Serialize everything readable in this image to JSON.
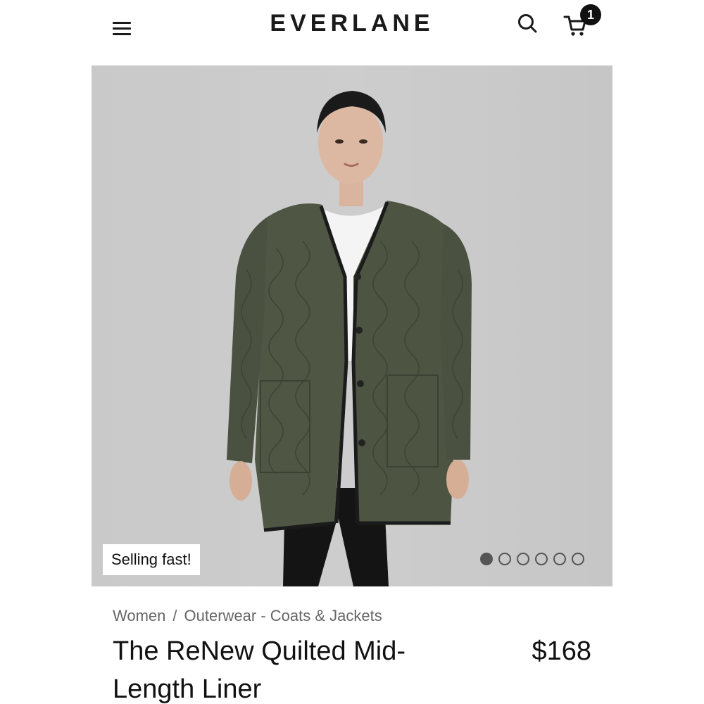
{
  "header": {
    "logo": "EVERLANE",
    "cart_count": "1"
  },
  "hero": {
    "badge": "Selling fast!",
    "carousel": {
      "total": 6,
      "active_index": 0
    }
  },
  "product": {
    "breadcrumb": {
      "category": "Women",
      "separator": "/",
      "subcategory": "Outerwear - Coats & Jackets"
    },
    "title": "The ReNew Quilted Mid-Length Liner",
    "price": "$168"
  },
  "colors": {
    "jacket": "#4f5644",
    "background": "#c9c9c9",
    "text": "#111111",
    "muted": "#666666"
  },
  "icons": {
    "menu": "hamburger-menu-icon",
    "search": "search-icon",
    "cart": "cart-icon"
  }
}
